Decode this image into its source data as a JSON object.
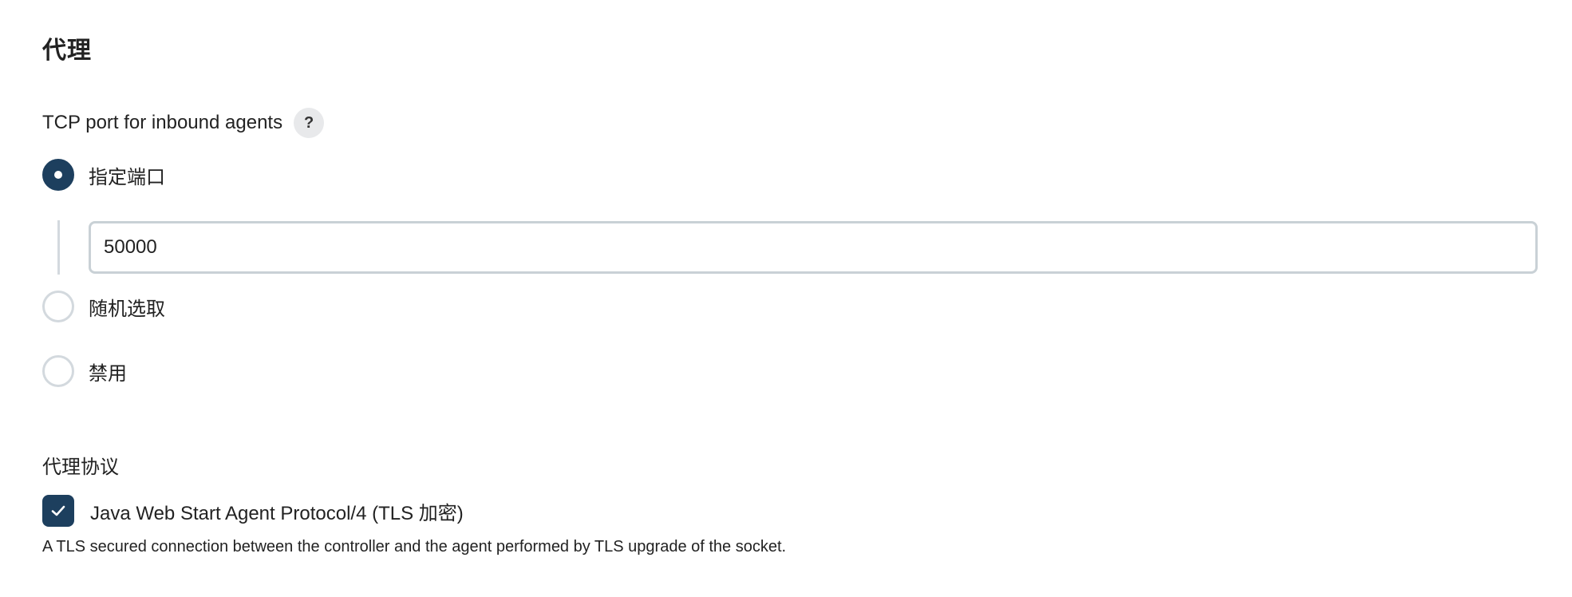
{
  "section": {
    "title": "代理"
  },
  "tcp_port": {
    "label": "TCP port for inbound agents",
    "help_label": "?",
    "options": [
      {
        "label": "指定端口",
        "checked": true
      },
      {
        "label": "随机选取",
        "checked": false
      },
      {
        "label": "禁用",
        "checked": false
      }
    ],
    "port_value": "50000"
  },
  "protocols": {
    "title": "代理协议",
    "items": [
      {
        "label": "Java Web Start Agent Protocol/4 (TLS 加密)",
        "checked": true,
        "description": "A TLS secured connection between the controller and the agent performed by TLS upgrade of the socket."
      }
    ]
  },
  "colors": {
    "accent": "#1d3f5e",
    "border": "#c9d1d6",
    "help_bg": "#e8e9eb"
  }
}
